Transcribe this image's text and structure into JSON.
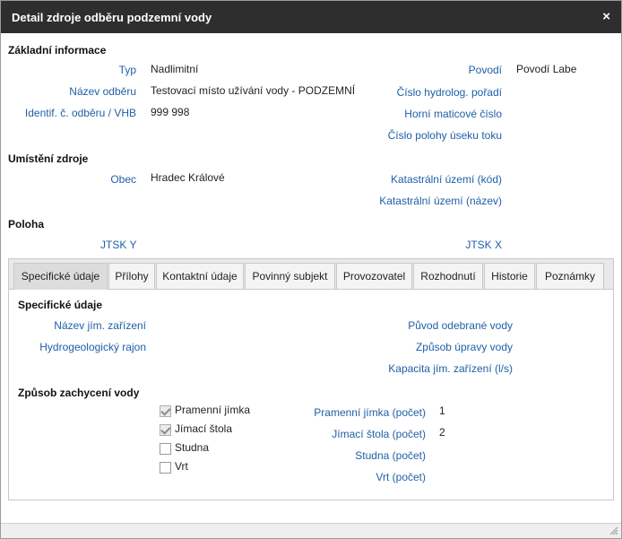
{
  "window": {
    "title": "Detail zdroje odběru podzemní vody",
    "close": "×"
  },
  "basic": {
    "heading": "Základní informace",
    "typ_label": "Typ",
    "typ_value": "Nadlimitní",
    "nazev_label": "Název odběru",
    "nazev_value": "Testovací místo užívání vody - PODZEMNÍ",
    "identif_label": "Identif. č. odběru / VHB",
    "identif_value": "999 998",
    "povodi_label": "Povodí",
    "povodi_value": "Povodí Labe",
    "cislo_hydro_label": "Číslo hydrolog. pořadí",
    "horni_label": "Horní maticové číslo",
    "cislo_polohy_label": "Číslo polohy úseku toku"
  },
  "location": {
    "heading": "Umístění zdroje",
    "obec_label": "Obec",
    "obec_value": "Hradec Králové",
    "kat_kod_label": "Katastrální území (kód)",
    "kat_nazev_label": "Katastrální území (název)"
  },
  "position": {
    "heading": "Poloha",
    "jtsk_y_label": "JTSK Y",
    "jtsk_x_label": "JTSK X"
  },
  "tabs": [
    {
      "label": "Specifické údaje",
      "active": true
    },
    {
      "label": "Přílohy",
      "active": false
    },
    {
      "label": "Kontaktní údaje",
      "active": false
    },
    {
      "label": "Povinný subjekt",
      "active": false
    },
    {
      "label": "Provozovatel",
      "active": false
    },
    {
      "label": "Rozhodnutí",
      "active": false
    },
    {
      "label": "Historie",
      "active": false
    },
    {
      "label": "Poznámky",
      "active": false
    }
  ],
  "specific": {
    "heading": "Specifické údaje",
    "nazev_zarizeni_label": "Název jím. zařízení",
    "rajon_label": "Hydrogeologický rajon",
    "puvod_label": "Původ odebrané vody",
    "zpusob_upravy_label": "Způsob úpravy vody",
    "kapacita_label": "Kapacita jím. zařízení (l/s)"
  },
  "capture": {
    "heading": "Způsob zachycení vody",
    "options": [
      {
        "label": "Pramenní jímka",
        "checked": true
      },
      {
        "label": "Jímací štola",
        "checked": true
      },
      {
        "label": "Studna",
        "checked": false
      },
      {
        "label": "Vrt",
        "checked": false
      }
    ],
    "counts": [
      {
        "label": "Pramenní jímka (počet)",
        "value": "1"
      },
      {
        "label": "Jímací štola (počet)",
        "value": "2"
      },
      {
        "label": "Studna (počet)",
        "value": ""
      },
      {
        "label": "Vrt (počet)",
        "value": ""
      }
    ]
  },
  "colors": {
    "titlebar": "#2e2e2e",
    "label": "#1f5fa6",
    "tab_active": "#dcdcdc"
  }
}
